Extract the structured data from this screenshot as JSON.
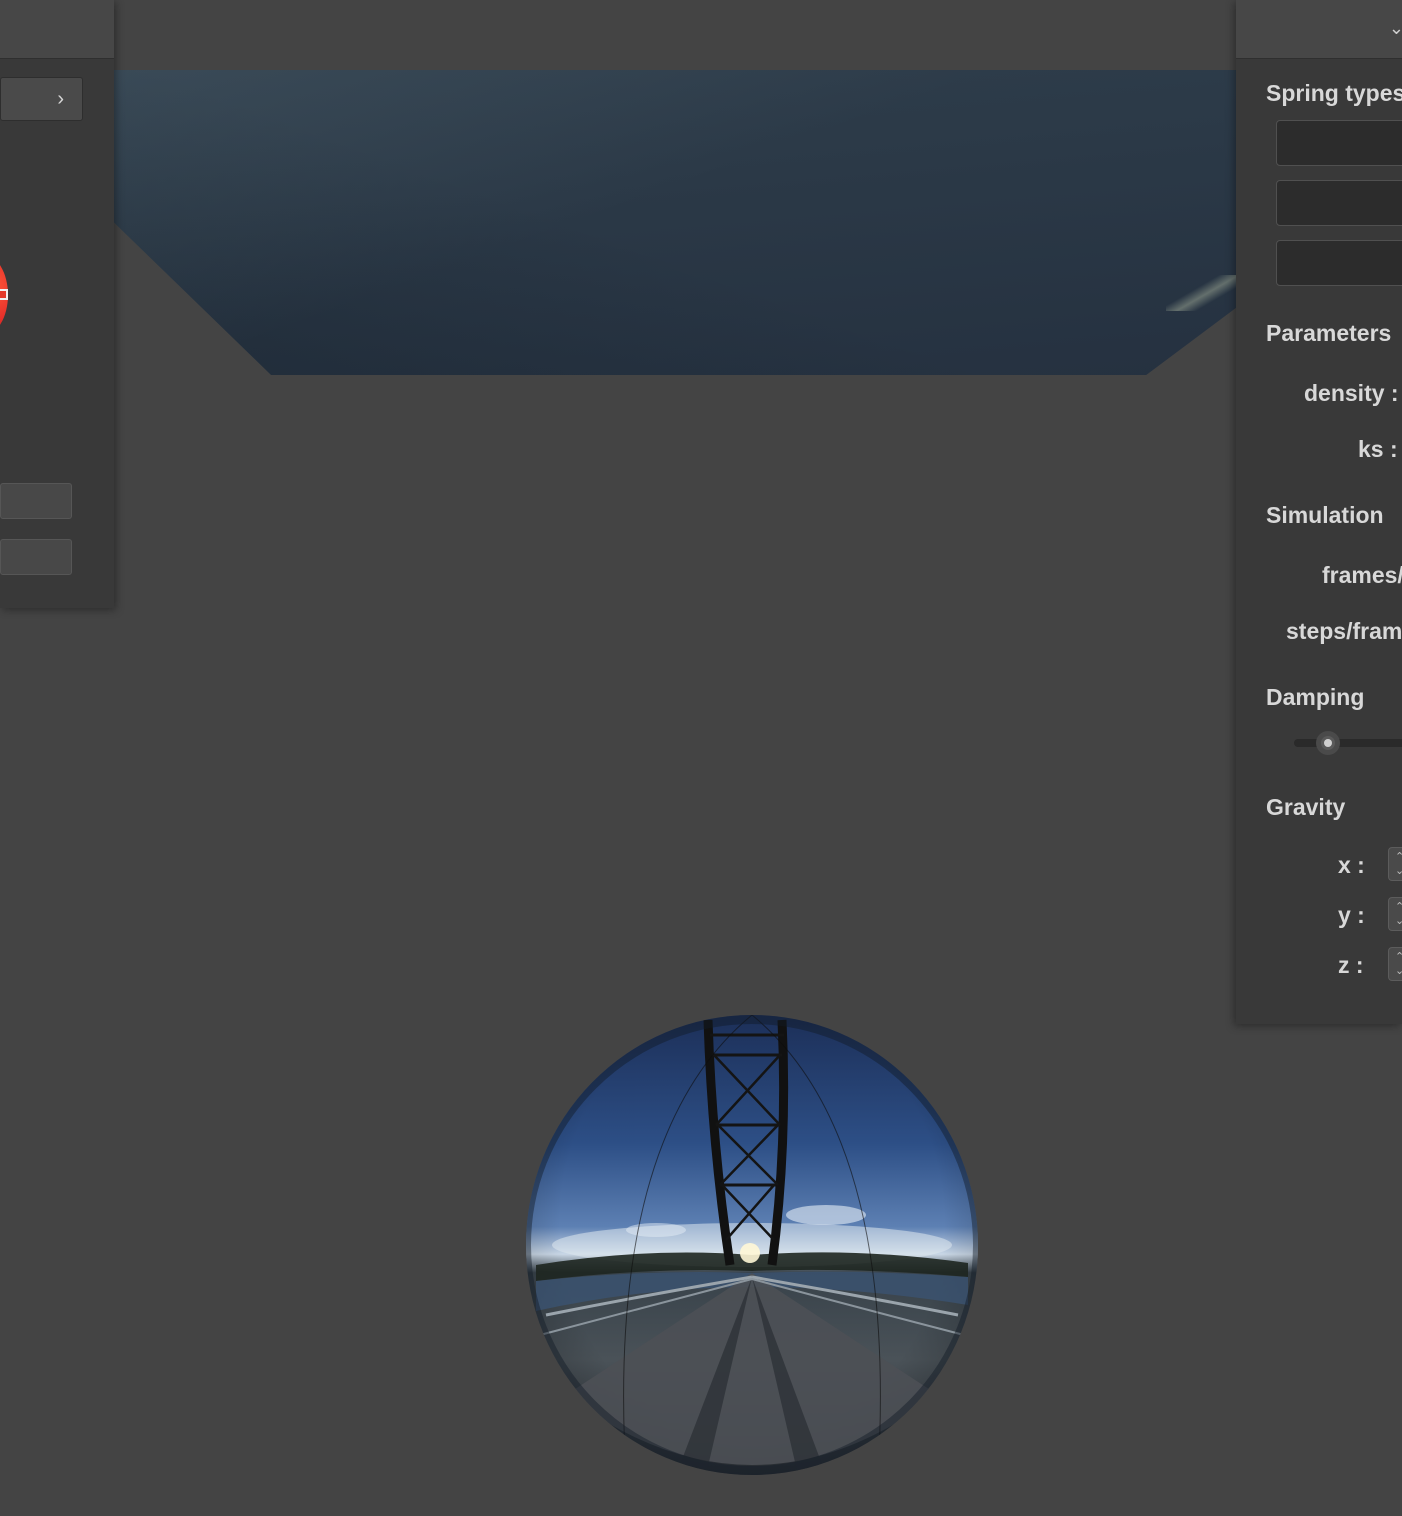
{
  "left_panel": {
    "expand_icon": "chevron-right-icon"
  },
  "right_panel": {
    "sections": {
      "spring_types": "Spring types",
      "parameters": "Parameters",
      "simulation": "Simulation",
      "damping": "Damping",
      "gravity": "Gravity"
    },
    "parameters": {
      "density_label": "density :",
      "ks_label": "ks :"
    },
    "simulation": {
      "frames_label": "frames/",
      "steps_label": "steps/fram"
    },
    "gravity": {
      "x_label": "x :",
      "y_label": "y :",
      "z_label": "z :"
    }
  },
  "colors": {
    "background": "#444444",
    "panel": "#393939",
    "panel_header": "#474747",
    "label_text": "#d8d8d8",
    "accent_red": "#e6302a"
  }
}
